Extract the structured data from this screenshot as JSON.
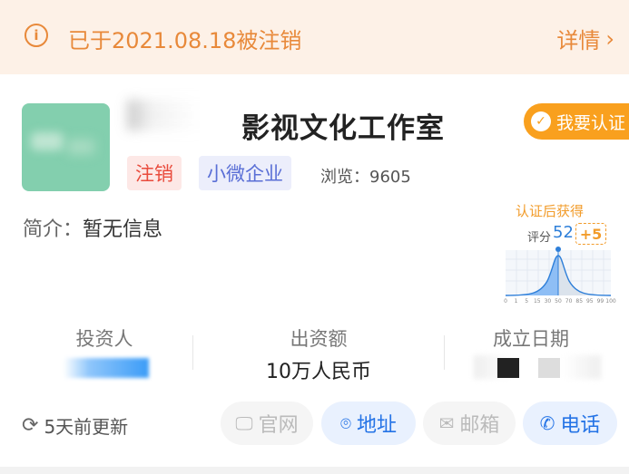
{
  "banner": {
    "status_text": "已于2021.08.18被注销",
    "details_label": "详情",
    "info_icon": "info-circle-icon",
    "chevron_icon": "chevron-right-icon"
  },
  "company": {
    "name": "影视文化工作室",
    "tags": [
      "注销",
      "小微企业"
    ],
    "views_label": "浏览：",
    "views_value": "9605",
    "intro_label": "简介：",
    "intro_value": "暂无信息"
  },
  "certify": {
    "button_label": "我要认证",
    "after_label": "认证后获得",
    "score_label": "评分",
    "score_value": "52",
    "bonus": "+5",
    "axis_ticks": [
      "0",
      "1",
      "5",
      "15",
      "30",
      "50",
      "70",
      "85",
      "95",
      "99",
      "100"
    ]
  },
  "stats": {
    "investor_label": "投资人",
    "capital_label": "出资额",
    "capital_value": "10万人民币",
    "date_label": "成立日期"
  },
  "footer": {
    "update_text": "5天前更新",
    "actions": [
      "官网",
      "地址",
      "邮箱",
      "电话"
    ]
  },
  "colors": {
    "accent_orange": "#e8893a",
    "blue": "#2473e6",
    "logo_green": "#83cfae"
  }
}
